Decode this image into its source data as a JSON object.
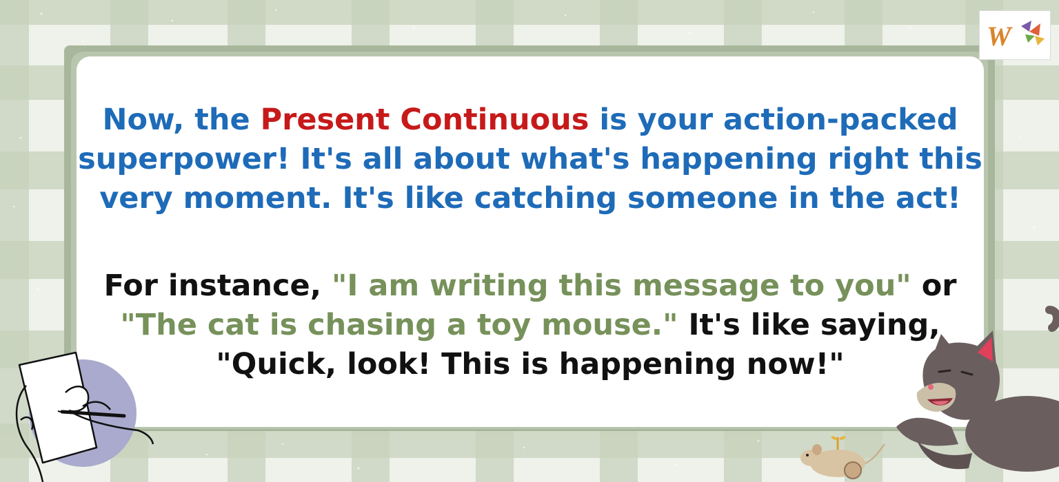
{
  "paragraph_1": {
    "before": "Now, the ",
    "highlight": "Present Continuous",
    "after": " is your action-packed superpower! It's all about what's happening right this very moment. It's like catching someone in the act!"
  },
  "paragraph_2": {
    "before": "For instance, ",
    "example_1": "\"I am writing this message to you\"",
    "middle": " or ",
    "example_2": "\"The cat is chasing a toy mouse.\"",
    "after": " It's like saying, \"Quick, look! This is happening now!\""
  },
  "logo": {
    "letter": "W"
  },
  "colors": {
    "body_text_blue": "#1e6bb8",
    "highlight_red": "#c61a1a",
    "example_green": "#76915a",
    "body_text_black": "#111111",
    "frame_green": "#a8b79b",
    "background_check": "#c7d2bc"
  },
  "icons": [
    "brand-logo-icon",
    "hand-writing-illustration-icon",
    "cat-illustration-icon",
    "toy-mouse-icon"
  ]
}
